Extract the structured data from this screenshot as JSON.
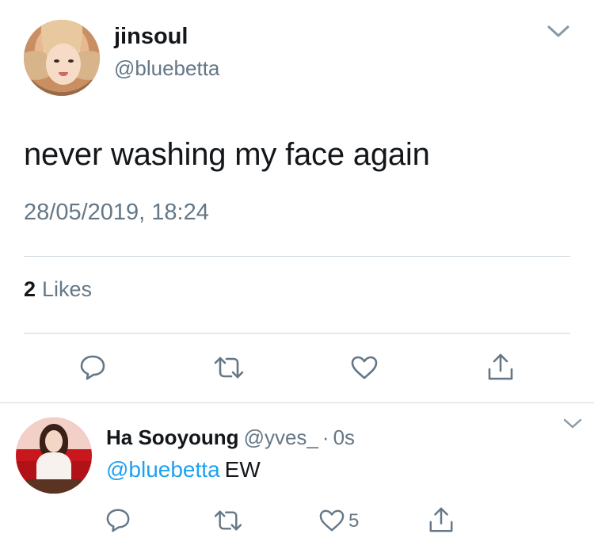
{
  "tweet": {
    "display_name": "jinsoul",
    "handle": "@bluebetta",
    "text": "never washing my face again",
    "timestamp": "28/05/2019, 18:24",
    "likes_count": "2",
    "likes_label": "Likes",
    "menu_icon": "chevron-down-icon",
    "actions": [
      "reply-icon",
      "retweet-icon",
      "like-icon",
      "share-icon"
    ]
  },
  "reply": {
    "display_name": "Ha Sooyoung",
    "handle": "@yves_",
    "separator": "·",
    "time": "0s",
    "mention": "@bluebetta",
    "text": "EW",
    "like_count": "5",
    "menu_icon": "chevron-down-icon",
    "actions": [
      "reply-icon",
      "retweet-icon",
      "like-icon",
      "share-icon"
    ]
  },
  "colors": {
    "text_primary": "#14171a",
    "text_secondary": "#657786",
    "accent_link": "#1da1f2",
    "divider": "#ccd6dd"
  }
}
